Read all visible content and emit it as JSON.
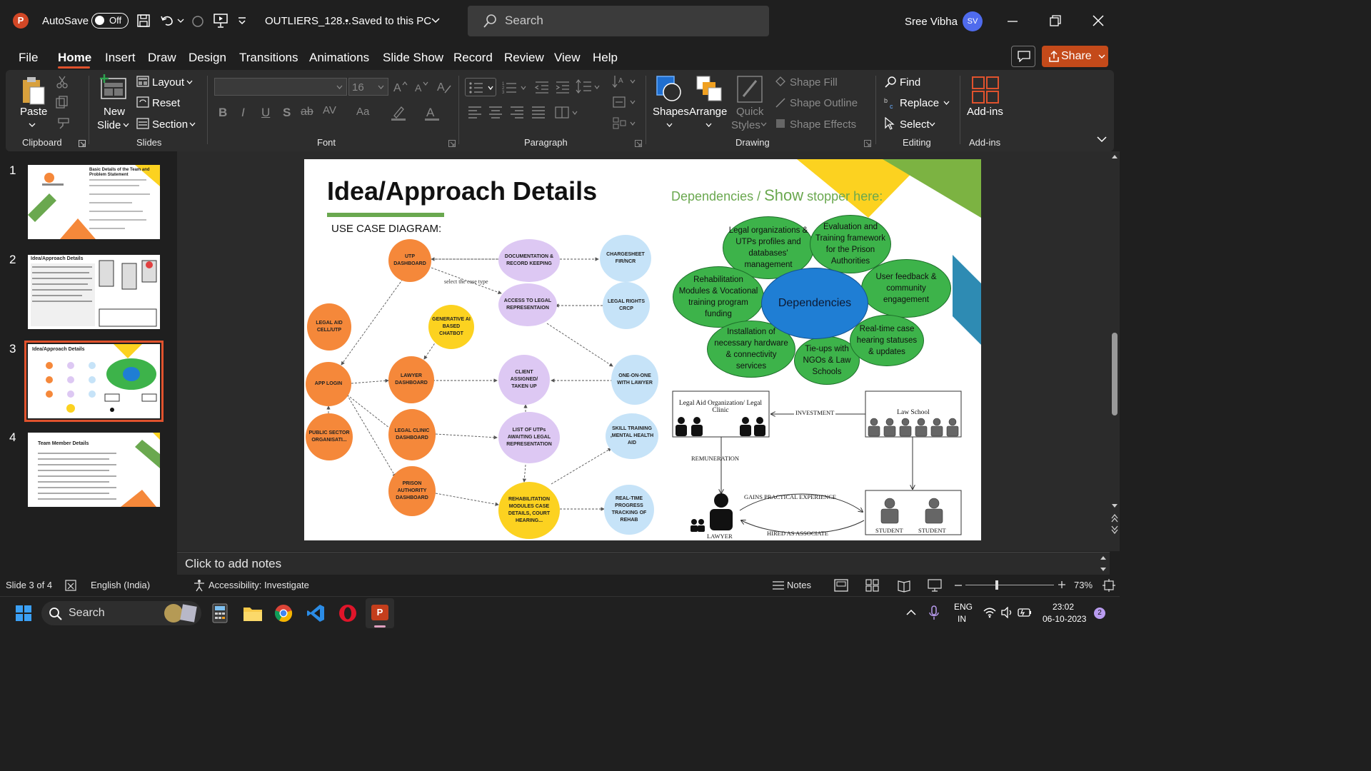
{
  "titlebar": {
    "autosave_label": "AutoSave",
    "autosave_state": "Off",
    "filename": "OUTLIERS_128...",
    "save_status": "• Saved to this PC",
    "search_placeholder": "Search",
    "user_name": "Sree Vibha",
    "user_initials": "SV"
  },
  "menu": {
    "items": [
      "File",
      "Home",
      "Insert",
      "Draw",
      "Design",
      "Transitions",
      "Animations",
      "Slide Show",
      "Record",
      "Review",
      "View",
      "Help"
    ],
    "active": "Home",
    "share_label": "Share"
  },
  "ribbon": {
    "clipboard": {
      "paste": "Paste",
      "label": "Clipboard"
    },
    "slides": {
      "new_slide_1": "New",
      "new_slide_2": "Slide",
      "layout": "Layout",
      "reset": "Reset",
      "section": "Section",
      "label": "Slides"
    },
    "font": {
      "font_size": "16",
      "label": "Font"
    },
    "paragraph": {
      "label": "Paragraph"
    },
    "drawing": {
      "shapes": "Shapes",
      "arrange": "Arrange",
      "quick_styles_1": "Quick",
      "quick_styles_2": "Styles",
      "shape_fill": "Shape Fill",
      "shape_outline": "Shape Outline",
      "shape_effects": "Shape Effects",
      "label": "Drawing"
    },
    "editing": {
      "find": "Find",
      "replace": "Replace",
      "select": "Select",
      "label": "Editing"
    },
    "addins": {
      "addins": "Add-ins",
      "label": "Add-ins"
    }
  },
  "thumbnails": [
    {
      "num": "1",
      "title": "Basic Details of the Team and Problem Statement"
    },
    {
      "num": "2",
      "title": "Idea/Approach Details"
    },
    {
      "num": "3",
      "title": "Idea/Approach Details"
    },
    {
      "num": "4",
      "title": "Team Member Details"
    }
  ],
  "slide": {
    "title": "Idea/Approach Details",
    "use_case_label": "USE CASE DIAGRAM:",
    "dependencies_heading_1": "Dependencies / ",
    "dependencies_heading_2": "Show",
    "dependencies_heading_3": " stopper here:",
    "edge_label": "select the case type",
    "nodes": {
      "utp_dashboard": "UTP DASHBOARD",
      "documentation": "DOCUMENTATION & RECORD KEEPING",
      "chargesheet": "CHARGESHEET FIR/NCR",
      "access_legal": "ACCESS TO LEGAL REPRESENTAION",
      "legal_rights": "LEGAL RIGHTS CRCP",
      "legal_aid_cell": "LEGAL AID CELL/UTP",
      "generative_ai": "GENERATIVE AI BASED CHATBOT",
      "app_login": "APP LOGIN",
      "lawyer_dashboard": "LAWYER DASHBOARD",
      "client_assigned": "CLIENT ASSIGNED/ TAKEN UP",
      "one_on_one": "ONE-ON-ONE WITH LAWYER",
      "public_sector": "PUBLIC SECTOR ORGANISATI...",
      "legal_clinic": "LEGAL CLINIC DASHBOARD",
      "list_utps": "LIST OF UTPs AWAITING LEGAL REPRESENTATION",
      "skill_training": "SKILL TRAINING ,MENTAL HEALTH AID",
      "prison_authority": "PRISON AUTHORITY DASHBOARD",
      "rehabilitation": "REHABILITATION MODULES CASE DETAILS, COURT HEARING...",
      "realtime_progress": "REAL-TIME PROGRESS TRACKING OF REHAB"
    },
    "dependencies": {
      "center": "Dependencies",
      "legal_orgs": "Legal organizations & UTPs profiles and databases' management",
      "evaluation": "Evaluation and Training framework for the Prison Authorities",
      "rehab_modules": "Rehabilitation Modules & Vocational training program funding",
      "user_feedback": "User feedback & community engagement",
      "installation": "Installation of necessary hardware & connectivity services",
      "tieups": "Tie-ups with NGOs & Law Schools",
      "realtime_case": "Real-time case hearing statuses & updates"
    },
    "flow": {
      "legal_aid_org": "Legal Aid Organization/ Legal Clinic",
      "investment": "INVESTMENT",
      "law_school": "Law School",
      "remuneration": "REMUNERATION",
      "gains_experience": "GAINS PRACTICAL EXPERIENCE",
      "hired_associate": "HIRED AS ASSOCIATE",
      "lawyer": "LAWYER",
      "student_1": "STUDENT",
      "student_2": "STUDENT"
    }
  },
  "notes_placeholder": "Click to add notes",
  "status": {
    "slide_of": "Slide 3 of 4",
    "language": "English (India)",
    "accessibility": "Accessibility: Investigate",
    "notes": "Notes",
    "zoom": "73%"
  },
  "taskbar": {
    "search": "Search",
    "lang_1": "ENG",
    "lang_2": "IN",
    "time": "23:02",
    "date": "06-10-2023",
    "badge": "2"
  },
  "colors": {
    "accent": "#e0522d",
    "orange_node": "#f5883a",
    "purple_node": "#ddc8f3",
    "blue_node": "#c6e3f8",
    "yellow_node": "#fcd220",
    "green_bubble": "#3db34a",
    "dependency_center": "#1f7ed4"
  }
}
